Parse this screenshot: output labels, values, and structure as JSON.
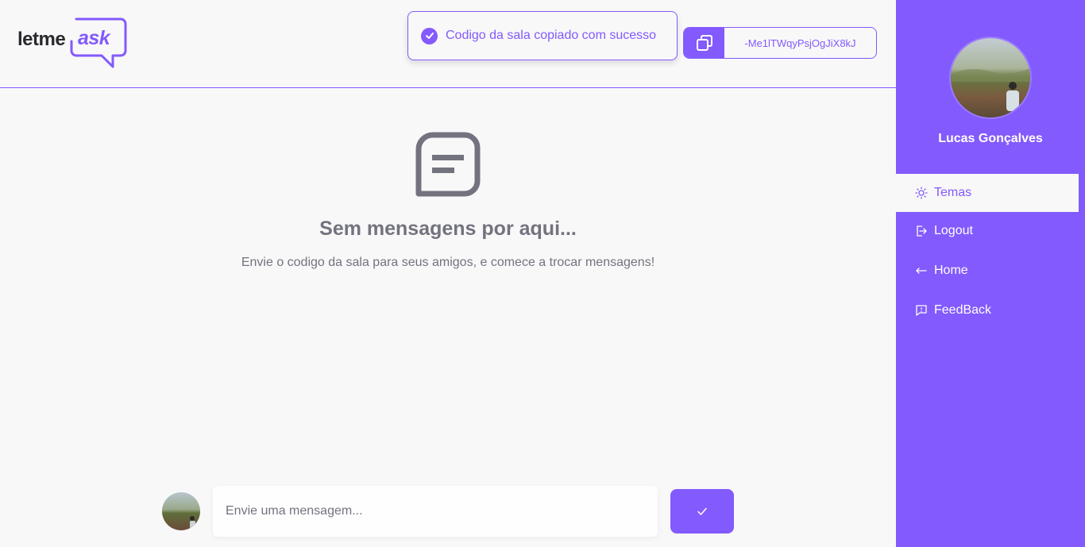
{
  "header": {
    "logo": {
      "part1": "letme",
      "part2": "ask"
    },
    "toast": {
      "message": "Codigo da sala copiado com sucesso",
      "icon": "check-circle-icon"
    },
    "room_code": {
      "value": "-Me1lTWqyPsjOgJiX8kJ",
      "icon": "copy-icon"
    }
  },
  "empty_state": {
    "icon": "message-square-icon",
    "title": "Sem mensagens por aqui...",
    "subtitle": "Envie o codigo da sala para seus amigos, e comece a trocar mensagens!"
  },
  "composer": {
    "placeholder": "Envie uma mensagem...",
    "send_icon": "check-icon"
  },
  "sidebar": {
    "user_name": "Lucas Gonçalves",
    "items": [
      {
        "label": "Temas",
        "icon": "sun-icon",
        "active": true
      },
      {
        "label": "Logout",
        "icon": "logout-icon",
        "active": false
      },
      {
        "label": "Home",
        "icon": "arrow-back-icon",
        "active": false
      },
      {
        "label": "FeedBack",
        "icon": "feedback-icon",
        "active": false
      }
    ]
  },
  "colors": {
    "accent": "#835afd",
    "background": "#f8f8f8",
    "muted_text": "#737380",
    "dark_text": "#29292e"
  }
}
